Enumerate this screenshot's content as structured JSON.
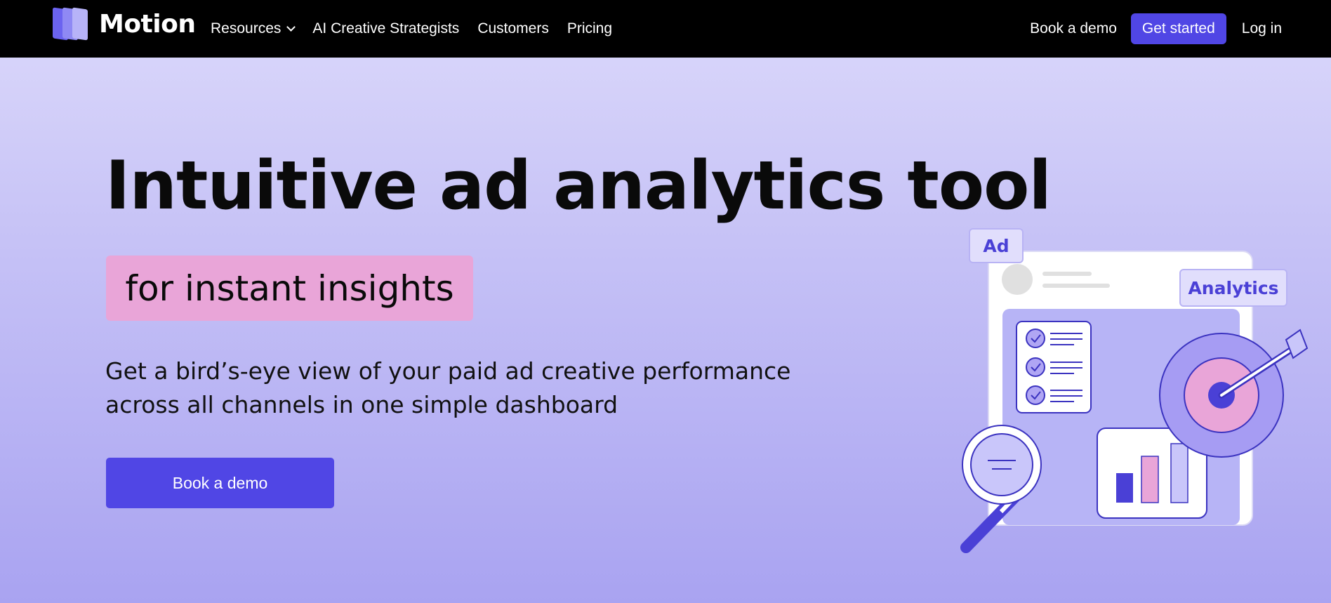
{
  "brand": {
    "name": "Motion"
  },
  "nav": {
    "items": [
      {
        "label": "Resources",
        "has_dropdown": true
      },
      {
        "label": "AI Creative Strategists"
      },
      {
        "label": "Customers"
      },
      {
        "label": "Pricing"
      }
    ],
    "book_demo": "Book a demo",
    "get_started": "Get started",
    "login": "Log in"
  },
  "hero": {
    "title": "Intuitive ad analytics tool",
    "highlight": "for instant insights",
    "subtitle": "Get a bird’s-eye view of your paid ad creative performance across all channels in one simple dashboard",
    "cta": "Book a demo"
  },
  "illustration": {
    "tag_ad": "Ad",
    "tag_analytics": "Analytics",
    "icons": [
      "checklist-icon",
      "bar-chart-icon",
      "target-icon",
      "magnifier-icon"
    ]
  },
  "colors": {
    "accent": "#5046e5",
    "highlight_pink": "#e9a5d8",
    "nav_bg": "#000000"
  }
}
